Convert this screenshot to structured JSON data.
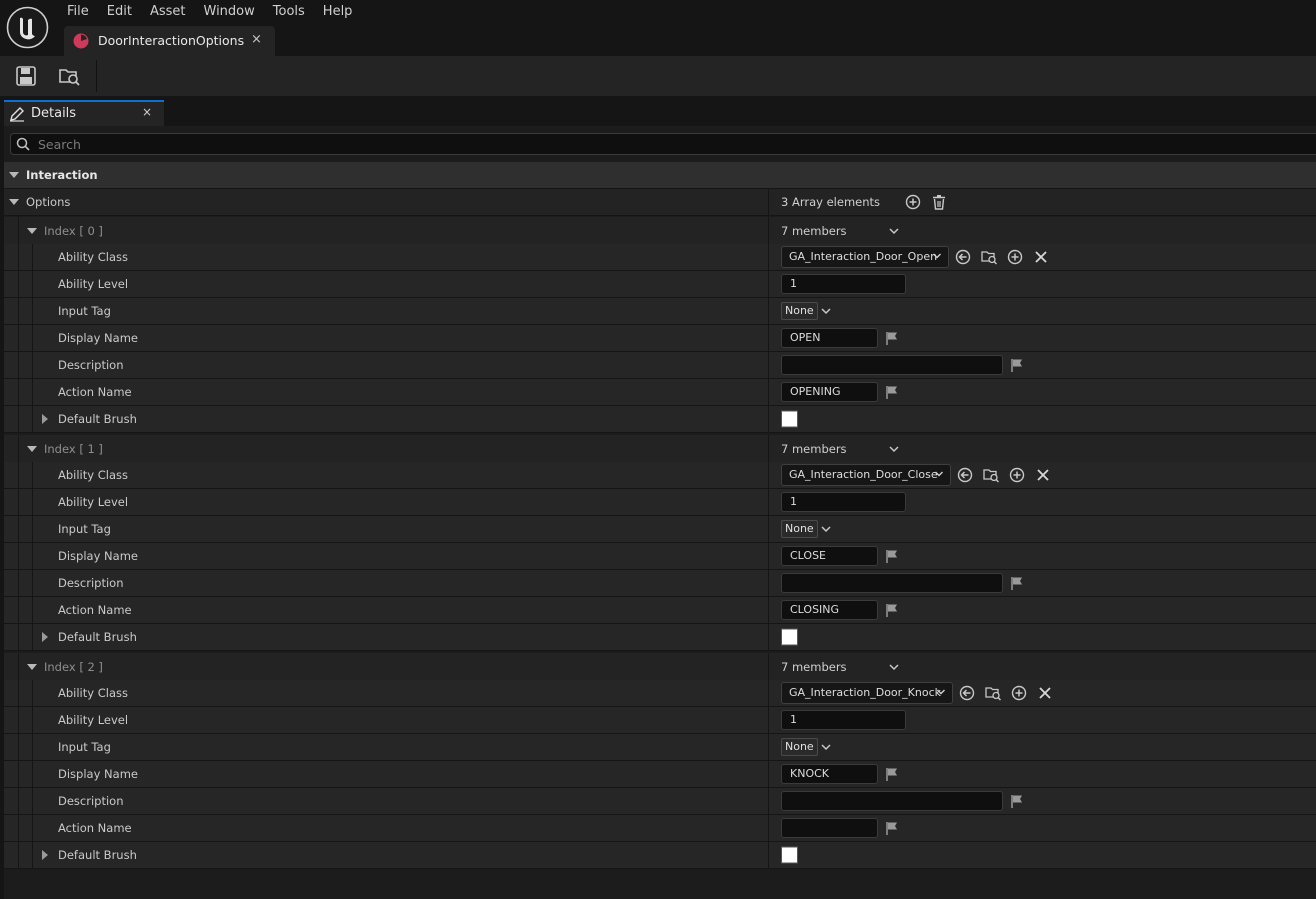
{
  "menu": [
    "File",
    "Edit",
    "Asset",
    "Window",
    "Tools",
    "Help"
  ],
  "document_tab": {
    "title": "DoorInteractionOptions",
    "close": "×"
  },
  "panel": {
    "tab_label": "Details",
    "close": "×",
    "search_placeholder": "Search"
  },
  "interaction": {
    "category": "Interaction",
    "options_label": "Options",
    "array_count": "3 Array elements",
    "members_label": "7 members",
    "property_labels": {
      "ability_class": "Ability Class",
      "ability_level": "Ability Level",
      "input_tag": "Input Tag",
      "display_name": "Display Name",
      "description": "Description",
      "action_name": "Action Name",
      "default_brush": "Default Brush"
    },
    "elements": [
      {
        "index_label": "Index [ 0 ]",
        "ability_class": "GA_Interaction_Door_Open",
        "ability_level": "1",
        "input_tag": "None",
        "display_name": "OPEN",
        "description": "",
        "action_name": "OPENING",
        "brush_color": "#ffffff"
      },
      {
        "index_label": "Index [ 1 ]",
        "ability_class": "GA_Interaction_Door_Close",
        "ability_level": "1",
        "input_tag": "None",
        "display_name": "CLOSE",
        "description": "",
        "action_name": "CLOSING",
        "brush_color": "#ffffff"
      },
      {
        "index_label": "Index [ 2 ]",
        "ability_class": "GA_Interaction_Door_Knock",
        "ability_level": "1",
        "input_tag": "None",
        "display_name": "KNOCK",
        "description": "",
        "action_name": "",
        "brush_color": "#ffffff"
      }
    ]
  },
  "icons": {
    "logo": "unreal-logo-icon",
    "save": "save-icon",
    "browse": "browse-to-asset-icon",
    "search": "search-icon",
    "add": "add-element-icon",
    "delete": "delete-all-icon",
    "use_selected": "use-selected-icon",
    "browse_class": "browse-class-icon",
    "new_class": "create-new-class-icon",
    "clear": "clear-icon",
    "localize": "localization-flag-icon"
  },
  "colors": {
    "accent_tab": "#0d6fd0",
    "asset_icon": "#d03a5a",
    "panel_bg": "#1c1c1c"
  }
}
